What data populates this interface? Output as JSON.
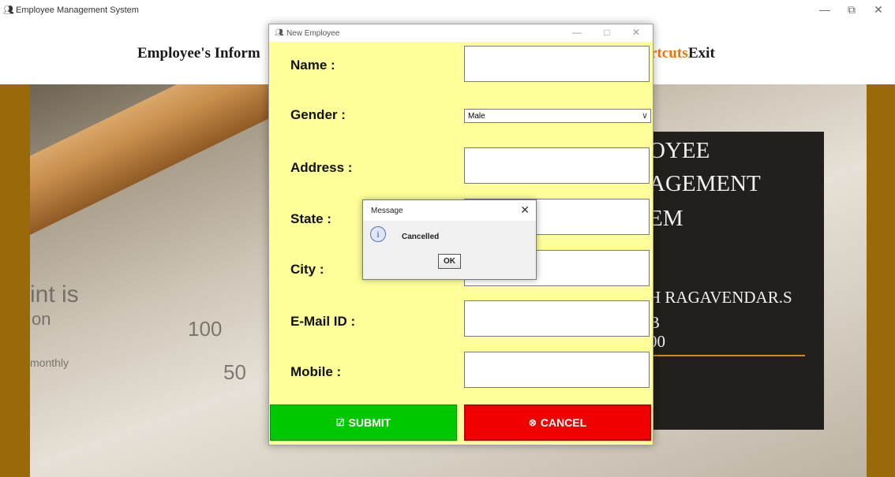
{
  "window": {
    "title": "Employee Management System",
    "icon": "people-icon"
  },
  "menu": {
    "info_label": "Employee's Inform",
    "shortcuts_label": "rtcuts",
    "exit_label": "Exit",
    "shortcuts_color": "#e8750c"
  },
  "banner": {
    "bg_text": [
      "int is",
      "on",
      "100",
      "50",
      "monthly"
    ],
    "panel_lines": [
      "OYEE",
      "AGEMENT",
      "EM",
      "H RAGAVENDAR.S",
      "B",
      "00"
    ],
    "accent": "#9a6a0a"
  },
  "dialog": {
    "title": "New Employee",
    "labels": {
      "name": "Name :",
      "gender": "Gender :",
      "address": "Address :",
      "state": "State :",
      "city": "City :",
      "email": "E-Mail ID :",
      "mobile": "Mobile :"
    },
    "gender_value": "Male",
    "submit_label": "SUBMIT",
    "cancel_label": "CANCEL",
    "background": "#ffff99",
    "submit_color": "#00c800",
    "cancel_color": "#f00000"
  },
  "message": {
    "title": "Message",
    "text": "Cancelled",
    "ok_label": "OK",
    "icon": "info-icon"
  }
}
